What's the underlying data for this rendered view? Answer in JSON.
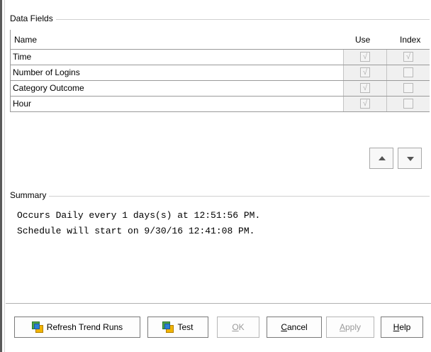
{
  "data_fields": {
    "title": "Data Fields",
    "columns": {
      "name": "Name",
      "use": "Use",
      "index": "Index"
    },
    "rows": [
      {
        "name": "Time",
        "use": true,
        "index": true
      },
      {
        "name": "Number of Logins",
        "use": true,
        "index": false
      },
      {
        "name": "Category Outcome",
        "use": true,
        "index": false
      },
      {
        "name": "Hour",
        "use": true,
        "index": false
      }
    ],
    "move_up_icon": "triangle-up",
    "move_down_icon": "triangle-down"
  },
  "summary": {
    "title": "Summary",
    "line1": "Occurs Daily every 1 days(s) at 12:51:56 PM.",
    "line2": "Schedule will start on 9/30/16 12:41:08 PM."
  },
  "buttons": {
    "refresh": "Refresh Trend Runs",
    "test": "Test",
    "ok": {
      "first": "O",
      "rest": "K"
    },
    "cancel": {
      "first": "C",
      "rest": "ancel"
    },
    "apply": {
      "first": "A",
      "rest": "pply"
    },
    "help": {
      "first": "H",
      "rest": "elp"
    }
  },
  "check_glyph": "√"
}
